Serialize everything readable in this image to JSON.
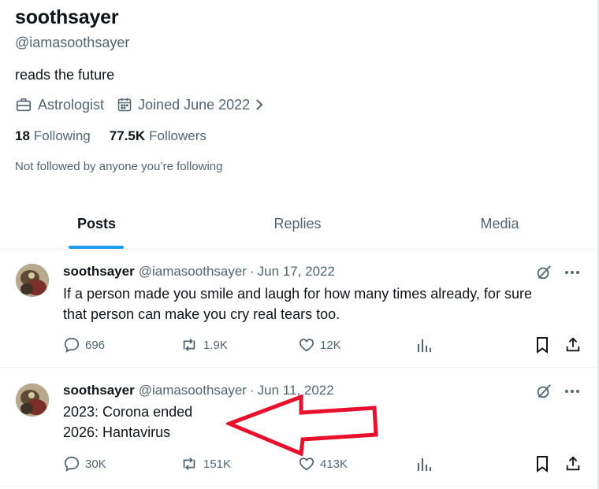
{
  "profile": {
    "name": "soothsayer",
    "handle": "@iamasoothsayer",
    "bio": "reads the future",
    "occupation": "Astrologist",
    "joined": "Joined June 2022",
    "following_count": "18",
    "following_label": "Following",
    "followers_count": "77.5K",
    "followers_label": "Followers",
    "not_followed_text": "Not followed by anyone you’re following"
  },
  "tabs": [
    {
      "label": "Posts",
      "active": true
    },
    {
      "label": "Replies",
      "active": false
    },
    {
      "label": "Media",
      "active": false
    }
  ],
  "posts": [
    {
      "author": "soothsayer",
      "handle": "@iamasoothsayer",
      "separator": "·",
      "date": "Jun 17, 2022",
      "lines": [
        "If a person made you smile and laugh for how many times already, for sure",
        "that person can make you cry real tears too."
      ],
      "replies": "696",
      "reposts": "1.9K",
      "likes": "12K"
    },
    {
      "author": "soothsayer",
      "handle": "@iamasoothsayer",
      "separator": "·",
      "date": "Jun 11, 2022",
      "lines": [
        "2023: Corona ended",
        "2026: Hantavirus"
      ],
      "replies": "30K",
      "reposts": "151K",
      "likes": "413K"
    }
  ],
  "colors": {
    "accent": "#1d9bf0",
    "text_primary": "#0f1419",
    "text_secondary": "#536471",
    "annotation_arrow": "#e8102c"
  },
  "icons": {
    "occupation": "briefcase-icon",
    "joined": "calendar-icon",
    "joined_expand": "chevron-right-icon",
    "grok": "grok-icon",
    "more": "more-icon",
    "reply": "reply-icon",
    "repost": "repost-icon",
    "like": "heart-icon",
    "views": "analytics-icon",
    "bookmark": "bookmark-icon",
    "share": "share-icon"
  }
}
